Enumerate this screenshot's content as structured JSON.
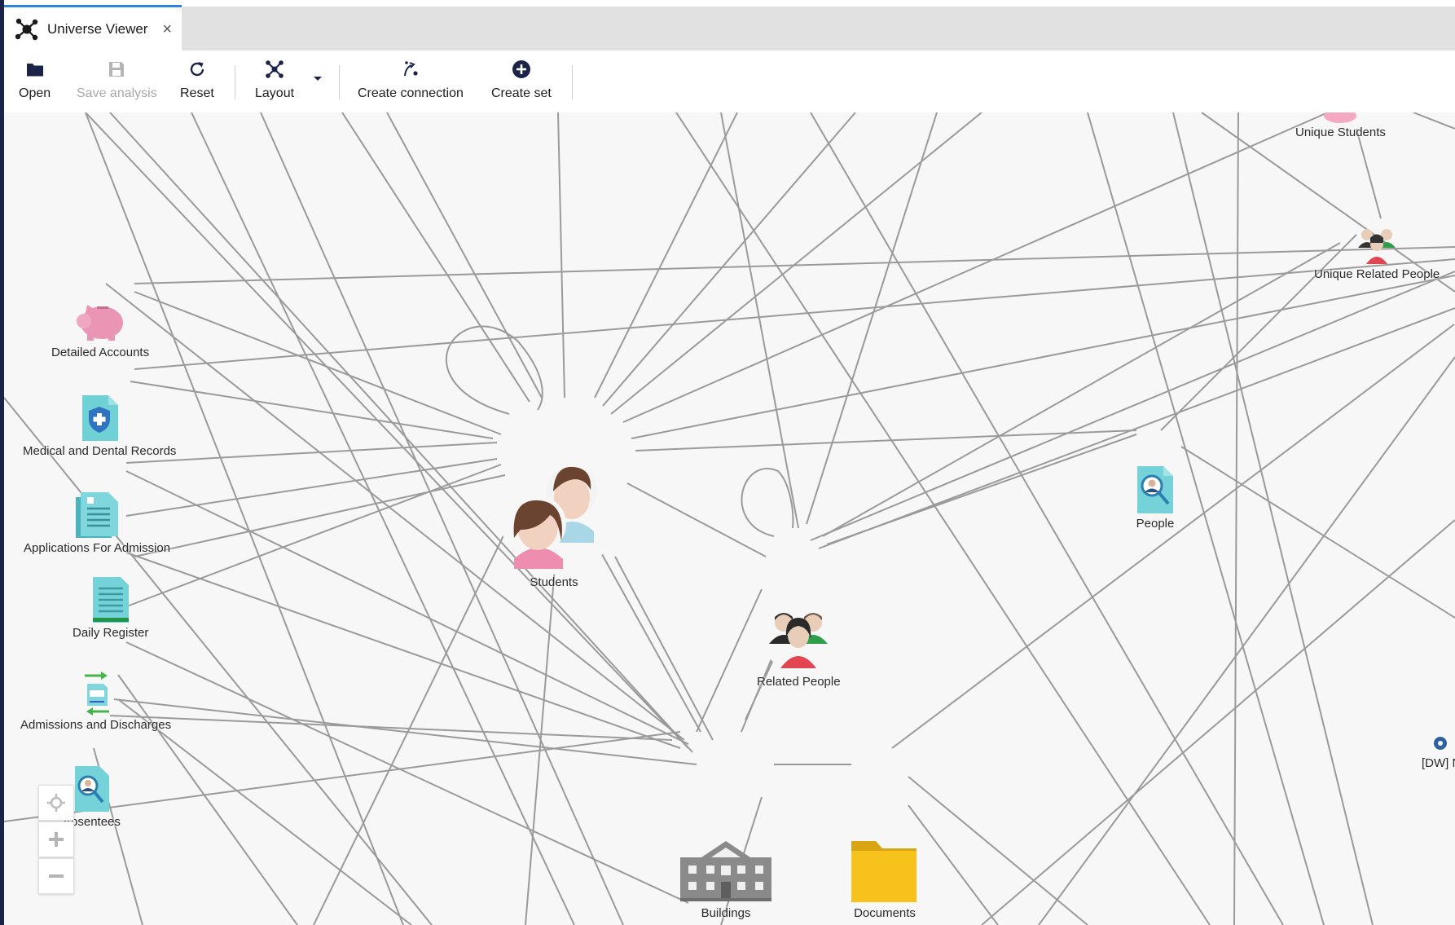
{
  "tab": {
    "title": "Universe Viewer",
    "close_glyph": "×"
  },
  "toolbar": {
    "open": "Open",
    "save": "Save analysis",
    "reset": "Reset",
    "layout": "Layout",
    "create_connection": "Create connection",
    "create_set": "Create set"
  },
  "nodes": {
    "unique_students": "Unique Students",
    "unique_related_people": "Unique Related People",
    "detailed_accounts": "Detailed Accounts",
    "medical_records": "Medical and Dental Records",
    "applications": "Applications For Admission",
    "daily_register": "Daily Register",
    "admissions_discharges": "Admissions and Discharges",
    "absentees": "Absentees",
    "students": "Students",
    "related_people": "Related People",
    "people": "People",
    "buildings": "Buildings",
    "documents": "Documents",
    "dw_partial": "[DW] N"
  },
  "colors": {
    "accent": "#2e86de",
    "edge": "#9a9a9a",
    "folder": "#f6c21b",
    "doc": "#6fd1d6"
  }
}
